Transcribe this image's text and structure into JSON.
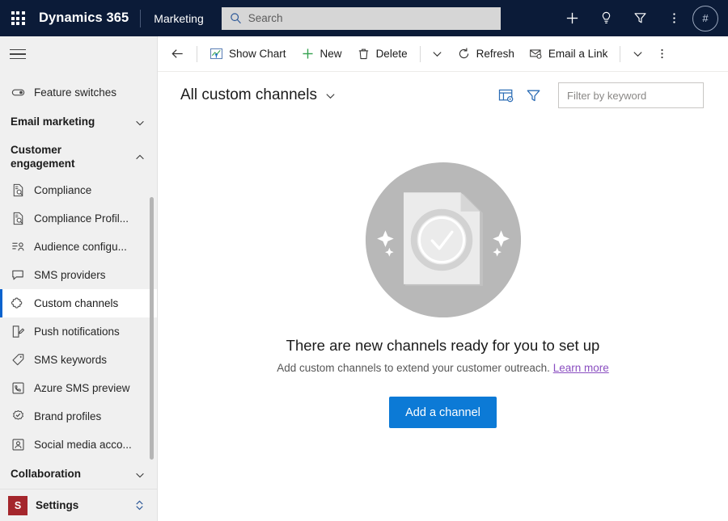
{
  "topbar": {
    "waffle_label": "app-launcher",
    "brand": "Dynamics 365",
    "app_name": "Marketing",
    "search_placeholder": "Search",
    "search_value": "",
    "avatar_initial": "#",
    "icons": [
      "plus-icon",
      "lightbulb-icon",
      "filter-icon",
      "more-vertical-icon"
    ]
  },
  "sidebar": {
    "items": [
      {
        "label": "Feature switches",
        "icon": "toggle-icon",
        "type": "item",
        "selected": false
      },
      {
        "label": "Email marketing",
        "icon": "chevron-down-icon",
        "type": "group",
        "expanded": false
      },
      {
        "label": "Customer engagement",
        "icon": "chevron-up-icon",
        "type": "group",
        "expanded": true
      },
      {
        "label": "Compliance",
        "icon": "document-search-icon",
        "type": "item",
        "selected": false
      },
      {
        "label": "Compliance Profil...",
        "icon": "document-search-icon",
        "type": "item",
        "selected": false
      },
      {
        "label": "Audience configu...",
        "icon": "audience-icon",
        "type": "item",
        "selected": false
      },
      {
        "label": "SMS providers",
        "icon": "chat-bubble-icon",
        "type": "item",
        "selected": false
      },
      {
        "label": "Custom channels",
        "icon": "puzzle-piece-icon",
        "type": "item",
        "selected": true
      },
      {
        "label": "Push notifications",
        "icon": "push-notification-icon",
        "type": "item",
        "selected": false
      },
      {
        "label": "SMS keywords",
        "icon": "tag-icon",
        "type": "item",
        "selected": false
      },
      {
        "label": "Azure SMS preview",
        "icon": "phone-preview-icon",
        "type": "item",
        "selected": false
      },
      {
        "label": "Brand profiles",
        "icon": "badge-check-icon",
        "type": "item",
        "selected": false
      },
      {
        "label": "Social media acco...",
        "icon": "person-frame-icon",
        "type": "item",
        "selected": false
      },
      {
        "label": "Collaboration",
        "icon": "chevron-down-icon",
        "type": "group",
        "expanded": false
      }
    ],
    "settings": {
      "badge": "S",
      "label": "Settings",
      "switcher_icon": "chevron-up-down-icon",
      "badge_color": "#a4262c"
    }
  },
  "commandbar": {
    "back": "back-arrow-icon",
    "show_chart": "Show Chart",
    "new": "New",
    "delete": "Delete",
    "refresh": "Refresh",
    "email_a_link": "Email a Link",
    "overflow": "more-vertical-icon"
  },
  "viewbar": {
    "title": "All custom channels",
    "title_chevron": "chevron-down-icon",
    "edit_columns_icon": "edit-columns-icon",
    "filter_icon": "filter-icon",
    "keyword_placeholder": "Filter by keyword",
    "keyword_value": ""
  },
  "empty_state": {
    "illustration": "document-check-sparkles-illustration",
    "title": "There are new channels ready for you to set up",
    "subtitle": "Add custom channels to extend your customer outreach.",
    "link": "Learn more",
    "button": "Add a channel"
  },
  "colors": {
    "header_bg": "#0b1b38",
    "accent_blue": "#0b63ce",
    "primary_button": "#0c7ad6",
    "link_purple": "#8a4ec0",
    "sidebar_bg": "#f0f0f0",
    "settings_badge": "#a4262c"
  }
}
